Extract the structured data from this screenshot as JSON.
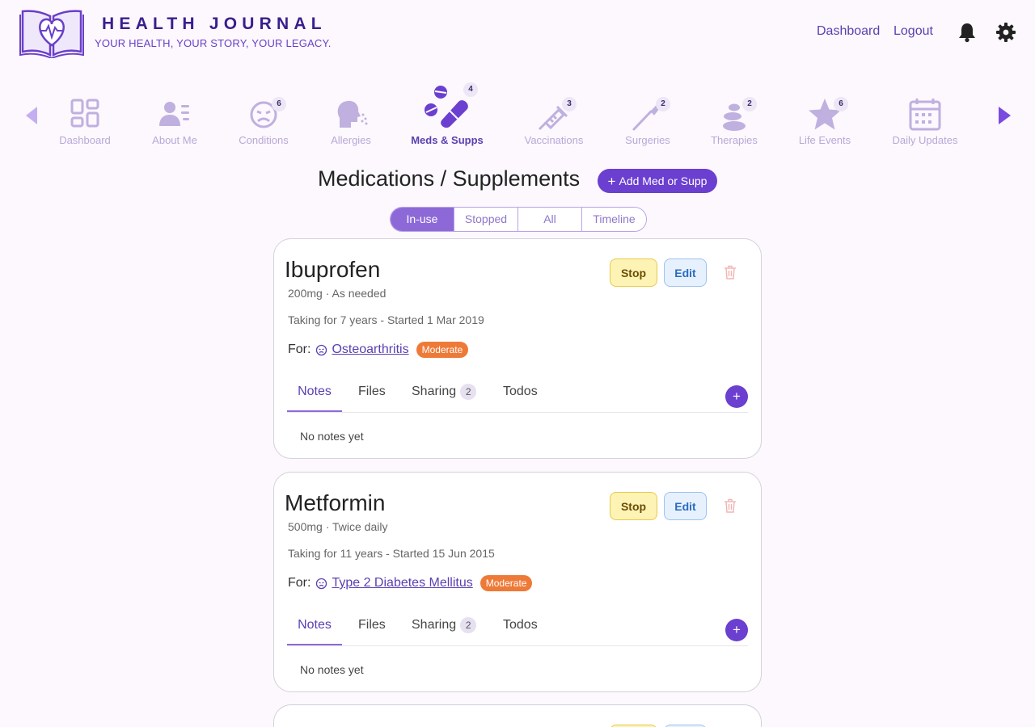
{
  "header": {
    "brand_title": "HEALTH JOURNAL",
    "tagline": "YOUR HEALTH, YOUR STORY, YOUR LEGACY.",
    "links": {
      "dashboard": "Dashboard",
      "logout": "Logout"
    },
    "icons": [
      "bell-icon",
      "gear-icon"
    ]
  },
  "nav": {
    "active": "Meds & Supps",
    "items": [
      {
        "label": "Dashboard",
        "icon": "dashboard-grid-icon",
        "badge": null
      },
      {
        "label": "About Me",
        "icon": "profile-card-icon",
        "badge": null
      },
      {
        "label": "Conditions",
        "icon": "sick-face-icon",
        "badge": "6"
      },
      {
        "label": "Allergies",
        "icon": "sneeze-head-icon",
        "badge": null
      },
      {
        "label": "Meds & Supps",
        "icon": "pills-capsule-icon",
        "badge": "4"
      },
      {
        "label": "Vaccinations",
        "icon": "syringe-icon",
        "badge": "3"
      },
      {
        "label": "Surgeries",
        "icon": "scalpel-icon",
        "badge": "2"
      },
      {
        "label": "Therapies",
        "icon": "stacked-stones-icon",
        "badge": "2"
      },
      {
        "label": "Life Events",
        "icon": "star-icon",
        "badge": "6"
      },
      {
        "label": "Daily Updates",
        "icon": "calendar-icon",
        "badge": null
      }
    ]
  },
  "page": {
    "title": "Medications / Supplements",
    "add_button": "Add Med or Supp",
    "filters": [
      "In-use",
      "Stopped",
      "All",
      "Timeline"
    ],
    "active_filter": "In-use"
  },
  "cards": [
    {
      "name": "Ibuprofen",
      "dose": "200mg · As needed",
      "duration": "Taking for 7 years - Started 1 Mar 2019",
      "for_label": "For:",
      "condition": "Osteoarthritis",
      "severity": "Moderate",
      "stop_label": "Stop",
      "edit_label": "Edit",
      "tabs": {
        "notes": "Notes",
        "files": "Files",
        "sharing": "Sharing",
        "sharing_count": "2",
        "todos": "Todos"
      },
      "empty_notes": "No notes yet"
    },
    {
      "name": "Metformin",
      "dose": "500mg · Twice daily",
      "duration": "Taking for 11 years - Started 15 Jun 2015",
      "for_label": "For:",
      "condition": "Type 2 Diabetes Mellitus",
      "severity": "Moderate",
      "stop_label": "Stop",
      "edit_label": "Edit",
      "tabs": {
        "notes": "Notes",
        "files": "Files",
        "sharing": "Sharing",
        "sharing_count": "2",
        "todos": "Todos"
      },
      "empty_notes": "No notes yet"
    }
  ],
  "colors": {
    "accent": "#6b3fd0",
    "nav_inactive": "#b8a8d8",
    "severity_moderate": "#ee7a38",
    "stop_bg": "#fdf3b5",
    "edit_bg": "#e7f1fd"
  }
}
